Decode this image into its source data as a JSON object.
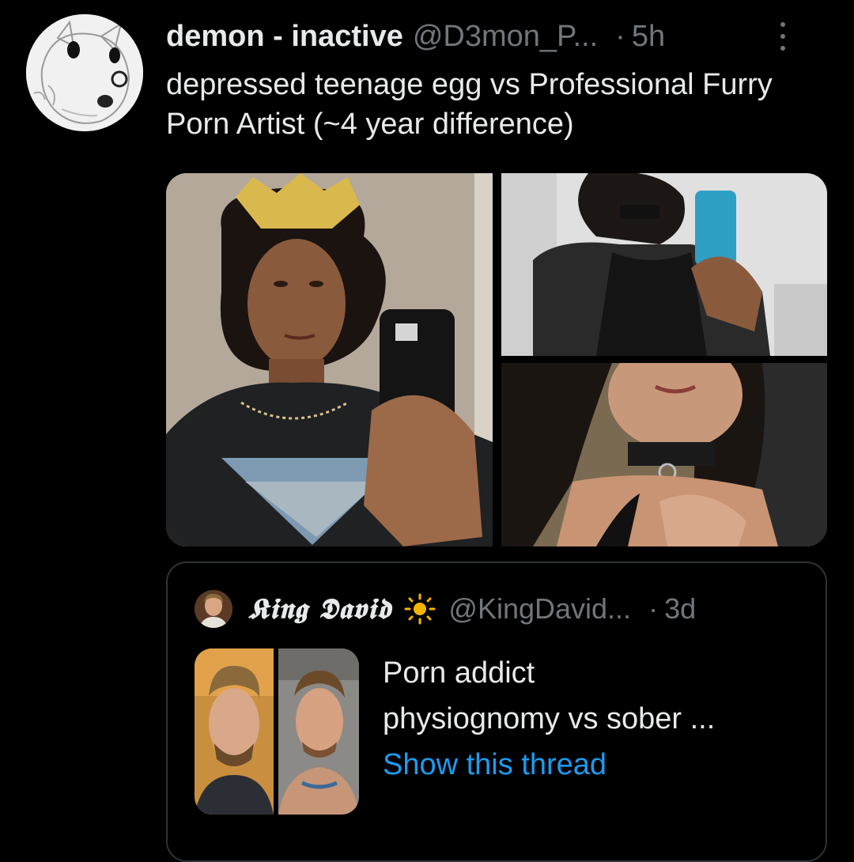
{
  "tweet": {
    "author": {
      "display_name": "demon - inactive",
      "handle": "@D3mon_P...",
      "avatar_icon": "drawn-character-avatar"
    },
    "separator": "·",
    "time": "5h",
    "text": "depressed teenage egg vs Professional Furry Porn Artist (~4 year difference)",
    "media": [
      {
        "description_icon": "photo-mirror-selfie-crown"
      },
      {
        "description_icon": "photo-mirror-selfie-leather"
      },
      {
        "description_icon": "photo-selfie-choker"
      }
    ]
  },
  "quote": {
    "author": {
      "display_name": "𝕶𝖎𝖓𝖌 𝕯𝖆𝖛𝖎𝖉",
      "emoji_icon": "sun-icon",
      "handle": "@KingDavid...",
      "avatar_icon": "person-avatar"
    },
    "separator": "·",
    "time": "3d",
    "text_line_1": "Porn addict",
    "text_line_2": "physiognomy vs sober ...",
    "show_thread": "Show this thread"
  },
  "colors": {
    "background": "#000000",
    "primary_text": "#e7e9ea",
    "secondary_text": "#71767b",
    "link": "#1d9bf0",
    "border": "#2f3336"
  }
}
